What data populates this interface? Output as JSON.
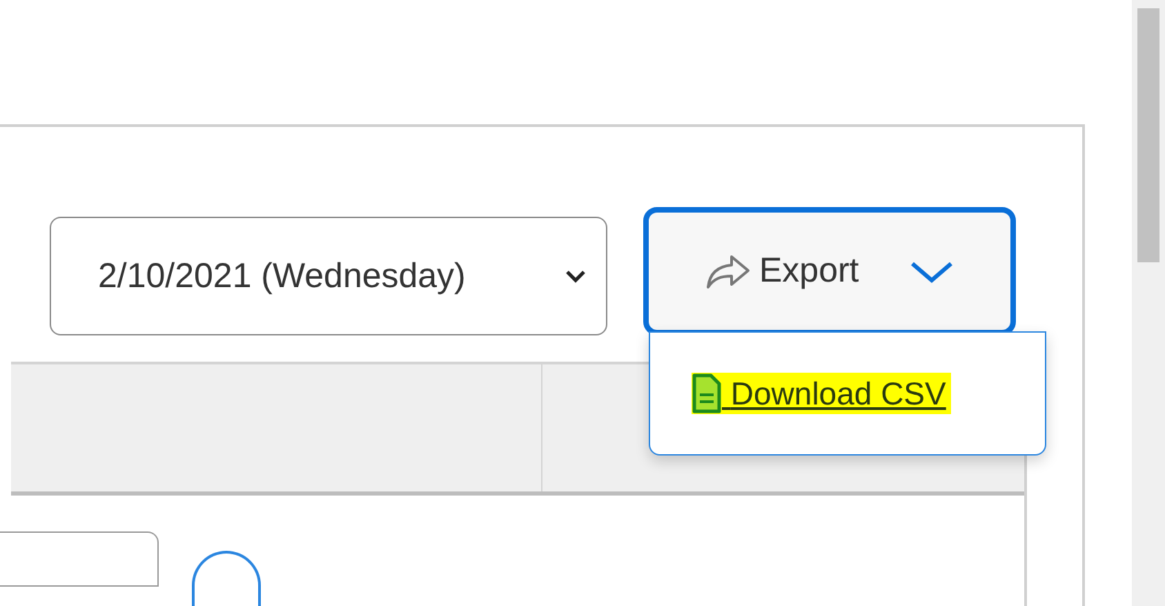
{
  "date_select": {
    "value": "2/10/2021 (Wednesday)"
  },
  "export_button": {
    "label": "Export",
    "expanded": true
  },
  "export_menu": {
    "items": [
      {
        "label": "Download CSV",
        "highlighted": true
      }
    ]
  }
}
